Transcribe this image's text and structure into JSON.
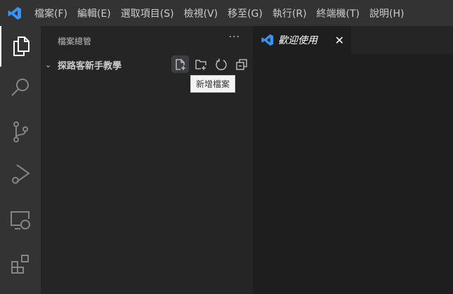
{
  "menu": [
    "檔案(F)",
    "編輯(E)",
    "選取項目(S)",
    "檢視(V)",
    "移至(G)",
    "執行(R)",
    "終端機(T)",
    "說明(H)"
  ],
  "sidebar": {
    "title": "檔案總管",
    "more": "···",
    "folder": "探路客新手教學",
    "tooltip": "新增檔案"
  },
  "tab": {
    "label": "歡迎使用",
    "close": "✕"
  },
  "colors": {
    "accent": "#3794ff"
  }
}
